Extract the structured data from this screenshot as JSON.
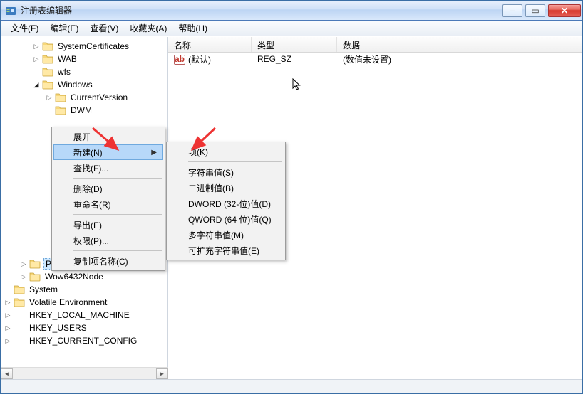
{
  "window": {
    "title": "注册表编辑器"
  },
  "menubar": {
    "file": "文件(F)",
    "edit": "编辑(E)",
    "view": "查看(V)",
    "favorites": "收藏夹(A)",
    "help": "帮助(H)"
  },
  "tree": {
    "n0": "SystemCertificates",
    "n1": "WAB",
    "n2": "wfs",
    "n3": "Windows",
    "n4": "CurrentVersion",
    "n5": "DWM",
    "n6": "Policies",
    "n7": "Wow6432Node",
    "n8": "System",
    "n9": "Volatile Environment",
    "n10": "HKEY_LOCAL_MACHINE",
    "n11": "HKEY_USERS",
    "n12": "HKEY_CURRENT_CONFIG"
  },
  "list": {
    "colName": "名称",
    "colType": "类型",
    "colData": "数据",
    "row0": {
      "name": "(默认)",
      "type": "REG_SZ",
      "data": "(数值未设置)"
    }
  },
  "ctx1": {
    "expand": "展开",
    "new": "新建(N)",
    "find": "查找(F)...",
    "delete": "删除(D)",
    "rename": "重命名(R)",
    "export": "导出(E)",
    "perm": "权限(P)...",
    "copyKeyName": "复制项名称(C)"
  },
  "ctx2": {
    "key": "项(K)",
    "string": "字符串值(S)",
    "binary": "二进制值(B)",
    "dword": "DWORD (32-位)值(D)",
    "qword": "QWORD (64 位)值(Q)",
    "multi": "多字符串值(M)",
    "expand": "可扩充字符串值(E)"
  }
}
